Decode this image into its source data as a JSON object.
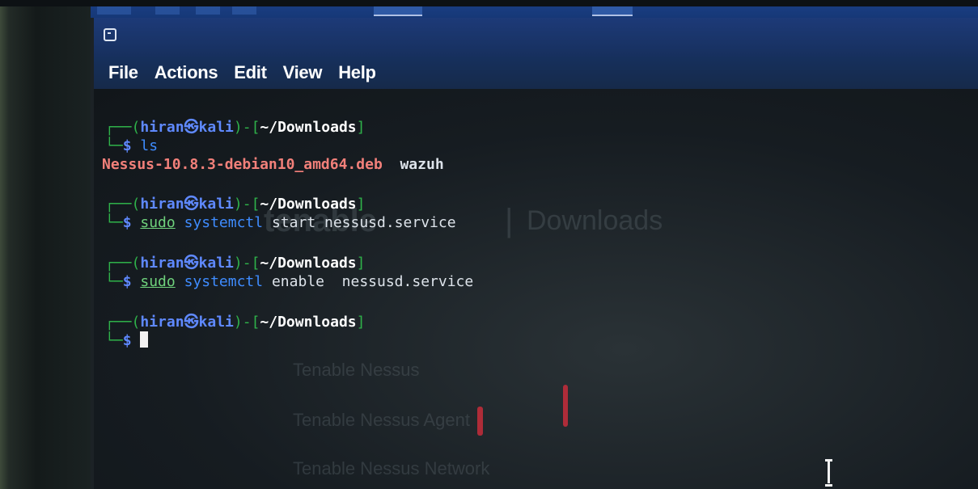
{
  "menu": {
    "file": "File",
    "actions": "Actions",
    "edit": "Edit",
    "view": "View",
    "help": "Help"
  },
  "prompt": {
    "open": "┌──(",
    "user": "hiran",
    "at_symbol": "㉿",
    "host": "kali",
    "mid": ")-[",
    "path": "~/Downloads",
    "close": "]",
    "corner": "└─",
    "dollar": "$"
  },
  "commands": [
    {
      "cmd": "ls",
      "args": ""
    },
    {
      "sudo": "sudo",
      "cmd": "systemctl",
      "args": "start nessusd.service"
    },
    {
      "sudo": "sudo",
      "cmd": "systemctl",
      "args": "enable  nessusd.service"
    }
  ],
  "ls_output": {
    "file1": "Nessus-10.8.3-debian10_amd64.deb",
    "file2": "wazuh"
  },
  "reflection": {
    "logo": "tenable",
    "separator": "|",
    "downloads": "Downloads",
    "items": [
      "Tenable Nessus",
      "Tenable Nessus Agent",
      "Tenable Nessus Network"
    ]
  },
  "colors": {
    "prompt_green": "#2fb24a",
    "prompt_blue": "#5f89ff",
    "file_red": "#f2807a",
    "command_blue": "#3f8cff",
    "menubar_blue": "#16305d"
  }
}
